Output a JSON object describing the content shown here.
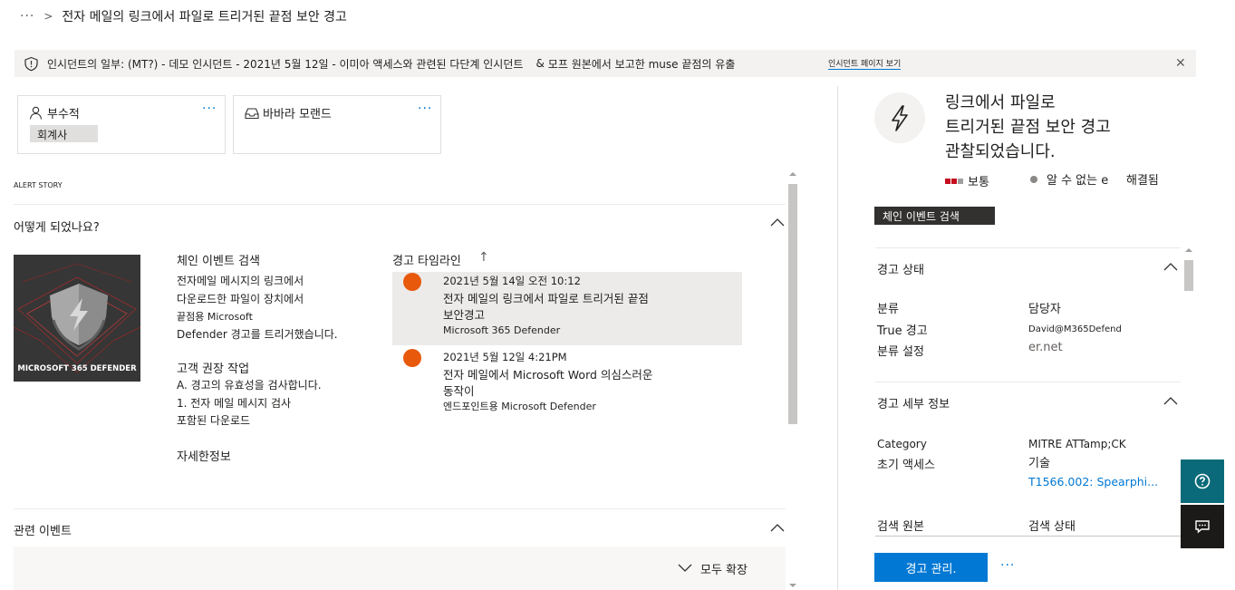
{
  "breadcrumb": {
    "more": "···",
    "sep": ">",
    "title": "전자 메일의 링크에서 파일로 트리거된 끝점 보안 경고"
  },
  "banner": {
    "incident_text": "인시던트의 일부: (MT?) - 데모 인시던트 - 2021년 5월 12일 - 이미아 액세스와 관련된 다단계 인시던트",
    "entity_text": "모프 원본에서 보고한 muse 끝점의 유출",
    "link_text": "인시던트 페이지 보기",
    "close": "✕"
  },
  "cards": [
    {
      "name": "부수적",
      "tag": "회계사",
      "more": "···"
    },
    {
      "name": "바바라 모랜드",
      "more": "···"
    }
  ],
  "alert_story": {
    "label": "ALERT STORY",
    "section_title": "어떻게 되었나요?",
    "image_caption": "MICROSOFT 365 DEFENDER",
    "detection_title": "체인 이벤트 검색",
    "detection_lines": [
      "전자메일 메시지의 링크에서",
      "다운로드한 파일이 장치에서",
      "끝점용 Microsoft",
      "Defender 경고를 트리거했습니다."
    ],
    "rec_title": "고객 권장 작업",
    "rec_lines": [
      "A. 경고의 유효성을 검사합니다.",
      "1. 전자 메일 메시지 검사",
      "포함된 다운로드"
    ],
    "more_info": "자세한정보"
  },
  "timeline": {
    "title": "경고 타임라인",
    "sort_icon": "↑",
    "items": [
      {
        "date": "2021년 5월 14일 오전 10:12",
        "title_lines": [
          "전자 메일의 링크에서 파일로 트리거된 끝점",
          "보안경고"
        ],
        "source": "Microsoft 365 Defender"
      },
      {
        "date": "2021년 5월 12일 4:21PM",
        "title_lines": [
          "전자 메일에서 Microsoft Word 의심스러운",
          "동작이"
        ],
        "source": "엔드포인트용 Microsoft Defender"
      }
    ]
  },
  "related": {
    "title": "관련 이벤트",
    "expand_all": "모두 확장"
  },
  "right": {
    "title_lines": [
      "링크에서 파일로",
      "트리거된 끝점 보안 경고",
      "관찰되었습니다."
    ],
    "severity": "보통",
    "status_unknown": "알 수 없는 e",
    "resolved": "해결됨",
    "detection_tag": "체인 이벤트 검색",
    "alert_state": {
      "title": "경고 상태",
      "classification_label": "분류",
      "classification_value": "True 경고",
      "set_classification": "분류 설정",
      "assigned_label": "담당자",
      "assigned_value_1": "David@M365Defend",
      "assigned_value_2": "er.net"
    },
    "alert_details": {
      "title": "경고 세부 정보",
      "category_label": "Category",
      "category_value": "초기 액세스",
      "mitre_label": "MITRE ATTamp;CK",
      "mitre_sub": "기술",
      "mitre_link": "T1566.002: Spearphi...",
      "detection_source_label": "검색 원본",
      "detection_status_label": "검색 상태"
    },
    "manage_button": "경고 관리.",
    "more": "···"
  },
  "colors": {
    "accent": "#0078d4",
    "timeline_dot": "#e8590c",
    "severity_red": "#c50f1f",
    "side_teal": "#0b6a79",
    "side_dark": "#1b1a19"
  }
}
